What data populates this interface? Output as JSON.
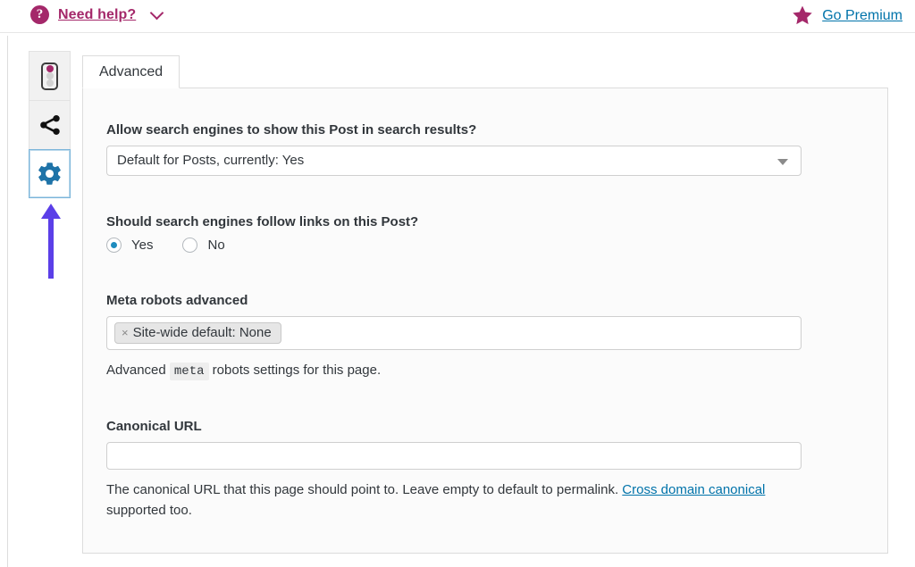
{
  "topbar": {
    "help_icon": "question-mark-circle-icon",
    "help_label": "Need help?",
    "help_chevron": "chevron-down-icon",
    "premium_icon": "star-icon",
    "premium_label": "Go Premium",
    "help_color": "#a4286a",
    "link_color": "#0073aa"
  },
  "sidebar": {
    "items": [
      {
        "name": "seo-analysis",
        "icon": "traffic-light-icon",
        "active": false
      },
      {
        "name": "social",
        "icon": "share-icon",
        "active": false
      },
      {
        "name": "advanced-settings",
        "icon": "gear-icon",
        "active": true
      }
    ],
    "active_icon_color": "#1e73a8",
    "annotation": {
      "icon": "up-arrow-annotation",
      "color": "#5b3fe8"
    }
  },
  "tabs": [
    {
      "label": "Advanced",
      "active": true
    }
  ],
  "form": {
    "index_field": {
      "label": "Allow search engines to show this Post in search results?",
      "value": "Default for Posts, currently: Yes",
      "caret": "caret-down-icon"
    },
    "follow_field": {
      "label": "Should search engines follow links on this Post?",
      "options": [
        {
          "label": "Yes",
          "checked": true
        },
        {
          "label": "No",
          "checked": false
        }
      ]
    },
    "meta_robots_field": {
      "label": "Meta robots advanced",
      "tag_remove": "×",
      "tag_value": "Site-wide default: None",
      "help_prefix": "Advanced",
      "help_code": "meta",
      "help_suffix": "robots settings for this page."
    },
    "canonical_field": {
      "label": "Canonical URL",
      "value": "",
      "placeholder": "",
      "help_part1": "The canonical URL that this page should point to. Leave empty to default to permalink.",
      "help_link": "Cross domain canonical",
      "help_part2": "supported too."
    }
  }
}
